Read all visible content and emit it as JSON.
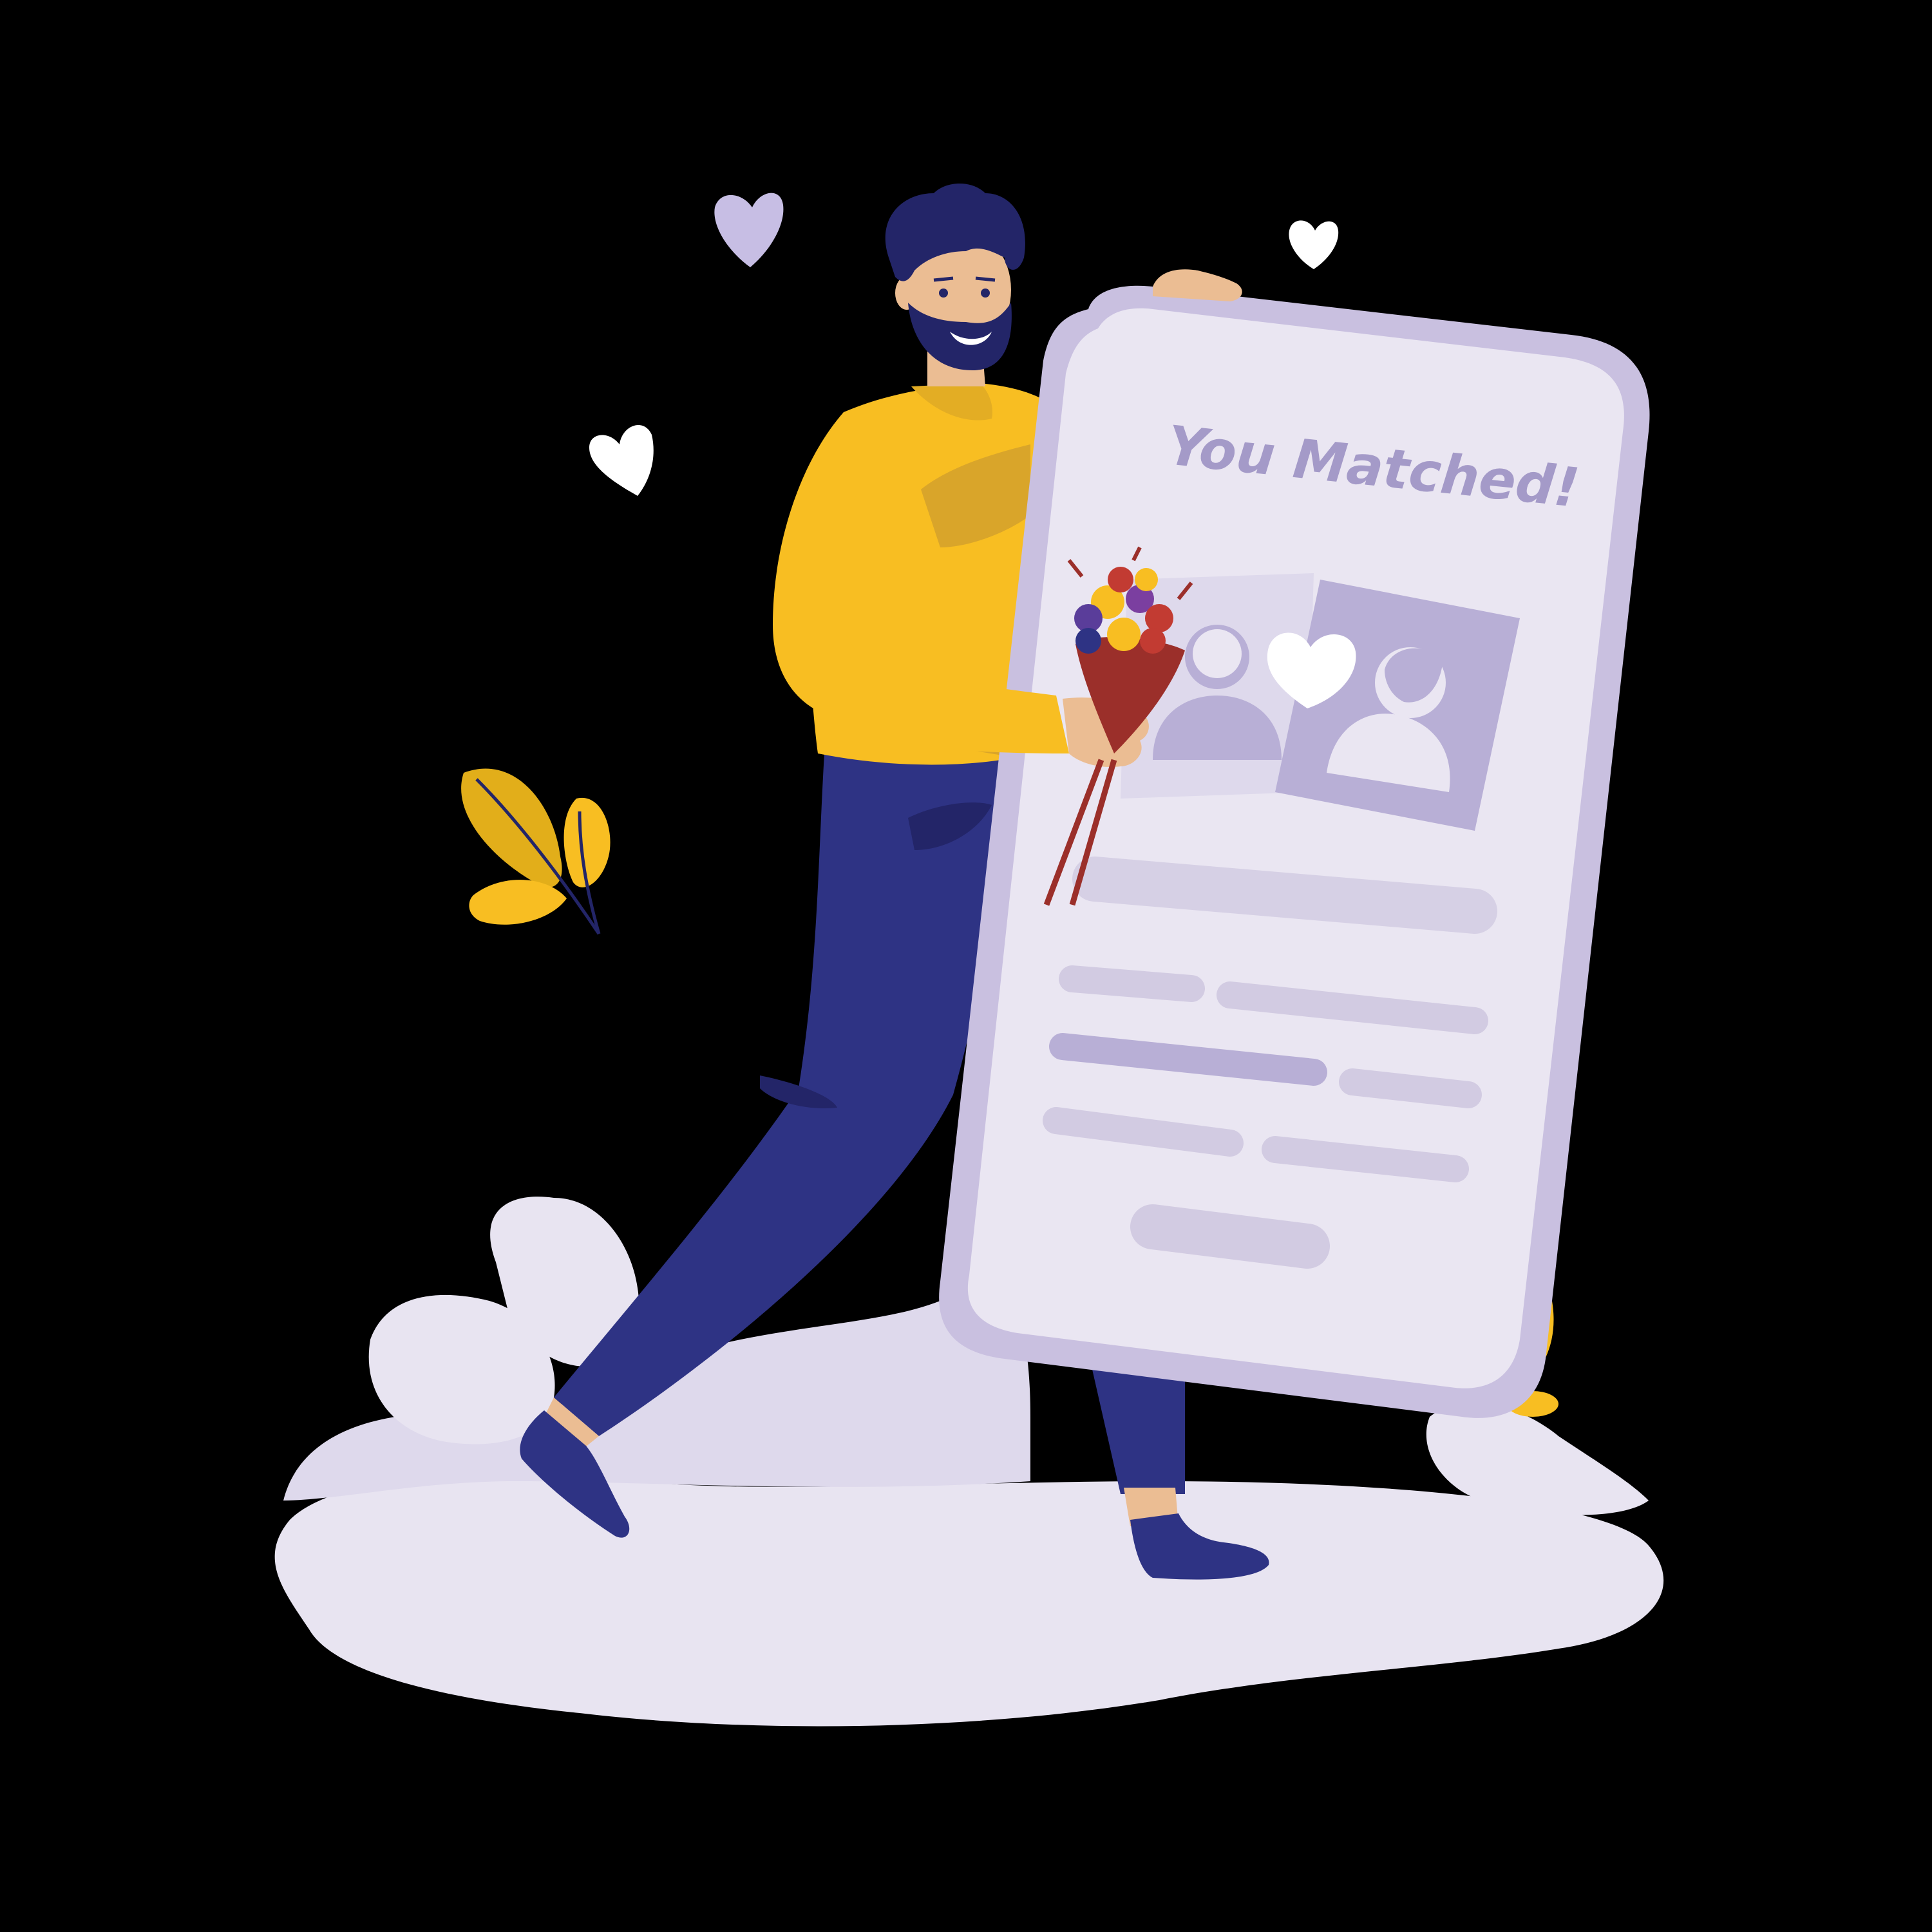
{
  "phone": {
    "headline": "You Matched!"
  },
  "colors": {
    "background": "#000000",
    "ground": "#E8E4F1",
    "phone_screen": "#EAE6F2",
    "phone_frame": "#C9C0E0",
    "placeholder": "#D2CBE2",
    "placeholder_dark": "#B8AFD6",
    "headline": "#A49AC8",
    "sweater": "#F8BE22",
    "pants": "#2E3384",
    "hair": "#232568",
    "skin": "#EBBD93",
    "heart_lavender": "#C7BEE4",
    "heart_white": "#FFFFFF",
    "leaf_yellow": "#F8BE22",
    "bouquet_wrap": "#9B2F2A"
  },
  "icons": [
    "heart-icon",
    "man-avatar-icon",
    "woman-avatar-icon",
    "leaf-sprig-icon",
    "bouquet-icon"
  ]
}
